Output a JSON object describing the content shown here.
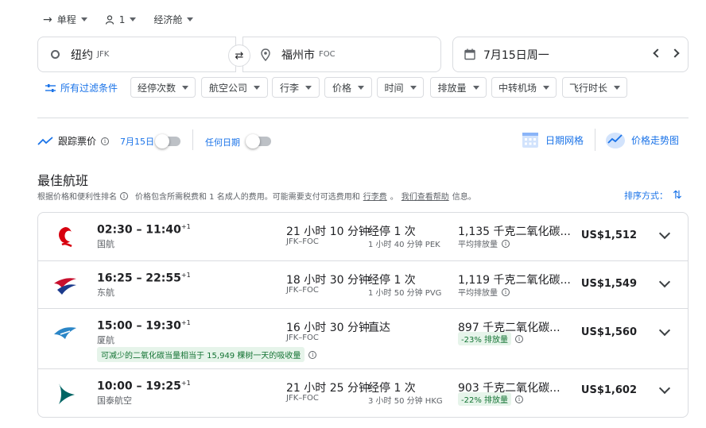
{
  "trip_bar": {
    "trip_type": "单程",
    "passengers": "1",
    "cabin": "经济舱"
  },
  "search": {
    "origin": "纽约",
    "origin_code": "JFK",
    "destination": "福州市",
    "destination_code": "FOC",
    "date": "7月15日周一"
  },
  "filters": {
    "all_filters": "所有过滤条件",
    "chips": [
      "经停次数",
      "航空公司",
      "行李",
      "价格",
      "时间",
      "排放量",
      "中转机场",
      "飞行时长"
    ]
  },
  "tracking": {
    "track_label": "跟踪票价",
    "date_label": "7月15日",
    "any_dates": "任何日期",
    "date_grid": "日期网格",
    "price_graph": "价格走势图"
  },
  "results": {
    "heading": "最佳航班",
    "subtitle_prefix": "根据价格和便利性排名",
    "subtitle_text": "价格包含所需税费和 1 名成人的费用。可能需要支付可选费用和",
    "bag_fees": "行李费",
    "subtitle_mid": "。",
    "help": "我们查看帮助",
    "subtitle_end": "信息。",
    "sort_label": "排序方式："
  },
  "flights": [
    {
      "time": "02:30 – 11:40",
      "plus": "+1",
      "airline": "国航",
      "duration": "21 小时 10 分钟",
      "route": "JFK–FOC",
      "stops": "经停 1 次",
      "layover": "1 小时 40 分钟 PEK",
      "co2": "1,135 千克二氧化碳...",
      "co2_sub": "平均排放量",
      "price": "US$1,512",
      "logo_color": "#d7000f"
    },
    {
      "time": "16:25 – 22:55",
      "plus": "+1",
      "airline": "东航",
      "duration": "18 小时 30 分钟",
      "route": "JFK–FOC",
      "stops": "经停 1 次",
      "layover": "1 小时 50 分钟 PVG",
      "co2": "1,119 千克二氧化碳...",
      "co2_sub": "平均排放量",
      "price": "US$1,549",
      "logo_color": "#c8102e"
    },
    {
      "time": "15:00 – 19:30",
      "plus": "+1",
      "airline": "厦航",
      "duration": "16 小时 30 分钟",
      "route": "JFK–FOC",
      "stops": "直达",
      "layover": "",
      "co2": "897 千克二氧化碳...",
      "co2_sub": "-23% 排放量",
      "price": "US$1,560",
      "note": "可减少的二氧化碳当量相当于 15,949 棵树一天的吸收量",
      "logo_color": "#2b86c7"
    },
    {
      "time": "10:00 – 19:25",
      "plus": "+1",
      "airline": "国泰航空",
      "duration": "21 小时 25 分钟",
      "route": "JFK–FOC",
      "stops": "经停 1 次",
      "layover": "3 小时 50 分钟 HKG",
      "co2": "903 千克二氧化碳...",
      "co2_sub": "-22% 排放量",
      "price": "US$1,602",
      "logo_color": "#006564"
    }
  ],
  "colors": {
    "accent": "#1a73e8",
    "green_badge": "#e6f4ea"
  }
}
